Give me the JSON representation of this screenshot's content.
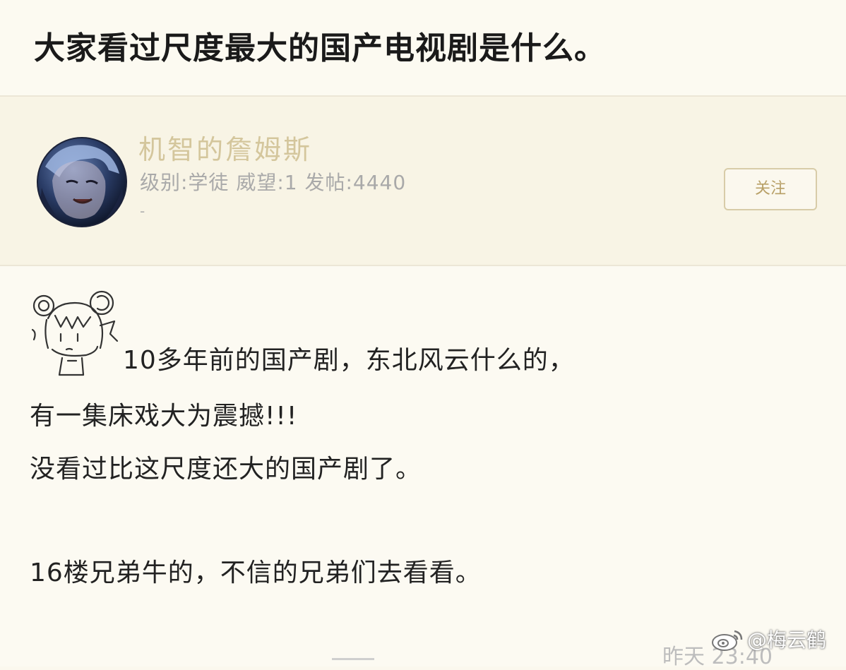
{
  "thread": {
    "title": "大家看过尺度最大的国产电视剧是什么。"
  },
  "author": {
    "name": "机智的詹姆斯",
    "meta": "级别:学徒 威望:1 发帖:4440",
    "dash": "-",
    "follow_label": "关注"
  },
  "post": {
    "line1": "10多年前的国产剧，东北风云什么的，",
    "line2": "有一集床戏大为震撼!!!",
    "line3": "没看过比这尺度还大的国产剧了。",
    "line4": "16楼兄弟牛的，不信的兄弟们去看看。",
    "timestamp": "昨天 23:40"
  },
  "watermark": {
    "text": "@梅云鹤"
  },
  "colors": {
    "background": "#fbf8ee",
    "author_name": "#d4c69c",
    "follow_accent": "#b8a067"
  },
  "icons": {
    "avatar": "anime-avatar",
    "sticker": "anime-girl-sticker",
    "watermark_logo": "weibo-icon"
  }
}
